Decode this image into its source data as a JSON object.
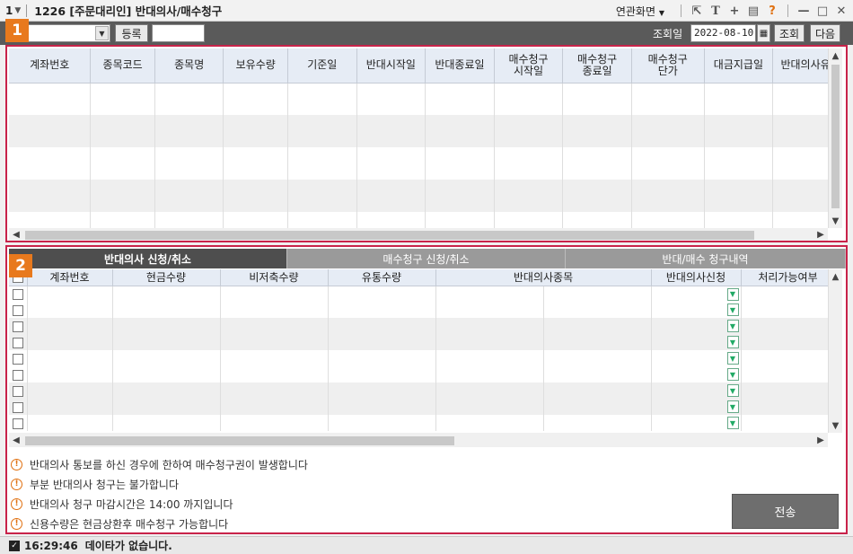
{
  "window": {
    "screen_no": "1",
    "title": "1226 [주문대리인] 반대의사/매수청구",
    "related_label": "연관화면"
  },
  "toolbar": {
    "register_label": "등록",
    "date_label": "조회일",
    "date_value": "2022-08-10",
    "query_label": "조회",
    "next_label": "다음"
  },
  "markers": {
    "m1": "1",
    "m2": "2"
  },
  "grid1": {
    "headers": [
      "계좌번호",
      "종목코드",
      "종목명",
      "보유수량",
      "기준일",
      "반대시작일",
      "반대종료일",
      "매수청구\n시작일",
      "매수청구\n종료일",
      "매수청구\n단가",
      "대금지급일",
      "반대의사유무"
    ]
  },
  "tabs": {
    "tab1": "반대의사 신청/취소",
    "tab2": "매수청구 신청/취소",
    "tab3": "반대/매수 청구내역"
  },
  "grid2": {
    "headers": [
      "계좌번호",
      "현금수량",
      "비저축수량",
      "유통수량",
      "반대의사종목",
      "반대의사신청",
      "처리가능여부"
    ]
  },
  "notes": [
    "반대의사 통보를 하신 경우에 한하여 매수청구권이 발생합니다",
    "부분 반대의사 청구는 불가합니다",
    "반대의사 청구 마감시간은 14:00 까지입니다",
    "신용수량은 현금상환후 매수청구 가능합니다"
  ],
  "send_label": "전송",
  "status": {
    "time": "16:29:46",
    "message": "데이타가 없습니다."
  }
}
